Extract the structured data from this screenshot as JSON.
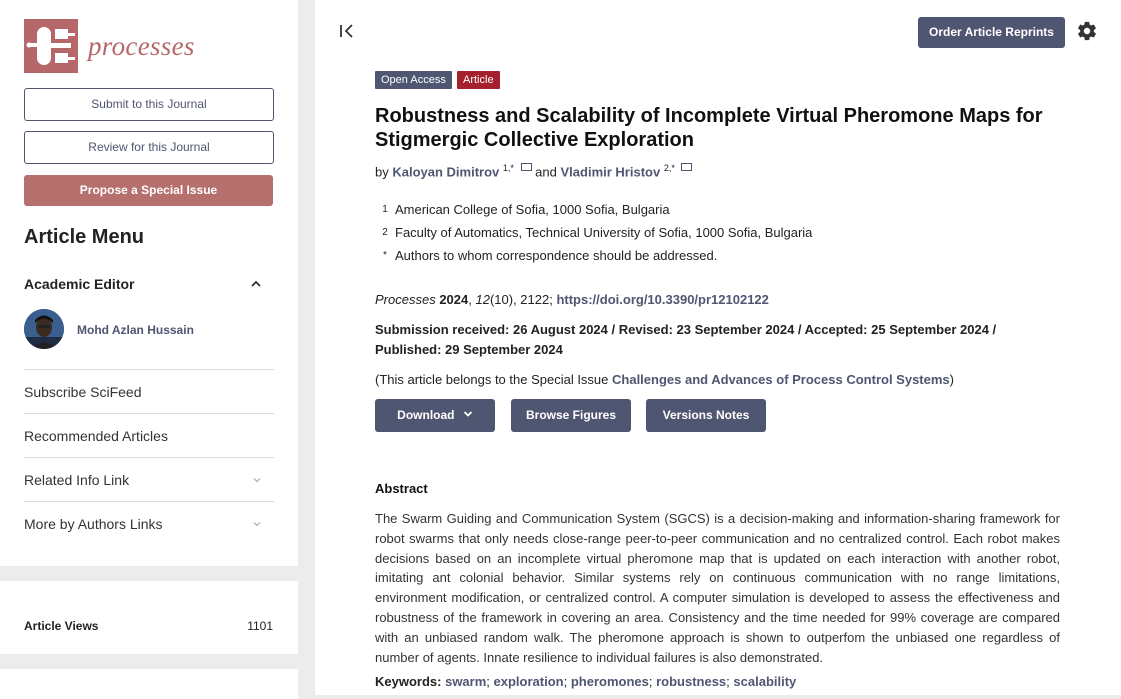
{
  "journal": {
    "name": "processes"
  },
  "sidebar": {
    "submit_label": "Submit to this Journal",
    "review_label": "Review for this Journal",
    "propose_label": "Propose a Special Issue",
    "menu_title": "Article Menu",
    "academic_editor_title": "Academic Editor",
    "editor_name": "Mohd Azlan Hussain",
    "items": [
      {
        "label": "Subscribe SciFeed"
      },
      {
        "label": "Recommended Articles"
      },
      {
        "label": "Related Info Link"
      },
      {
        "label": "More by Authors Links"
      }
    ],
    "article_views_label": "Article Views",
    "article_views_value": "1101"
  },
  "header": {
    "reprints_label": "Order Article Reprints"
  },
  "article": {
    "badges": {
      "open_access": "Open Access",
      "type": "Article"
    },
    "title": "Robustness and Scalability of Incomplete Virtual Pheromone Maps for Stigmergic Collective Exploration",
    "by": "by",
    "author1": {
      "name": "Kaloyan Dimitrov",
      "sup": "1,*"
    },
    "and": "and",
    "author2": {
      "name": "Vladimir Hristov",
      "sup": "2,*"
    },
    "affiliations": [
      {
        "num": "1",
        "text": "American College of Sofia, 1000 Sofia, Bulgaria"
      },
      {
        "num": "2",
        "text": "Faculty of Automatics, Technical University of Sofia, 1000 Sofia, Bulgaria"
      },
      {
        "num": "*",
        "text": "Authors to whom correspondence should be addressed."
      }
    ],
    "citation": {
      "journal": "Processes",
      "year": "2024",
      "volume": "12",
      "issue": "(10), 2122; ",
      "doi": "https://doi.org/10.3390/pr12102122"
    },
    "dates": "Submission received: 26 August 2024 / Revised: 23 September 2024 / Accepted: 25 September 2024 / Published: 29 September 2024",
    "special_issue": {
      "prefix": "(This article belongs to the Special Issue ",
      "name": "Challenges and Advances of Process Control Systems",
      "suffix": ")"
    },
    "buttons": {
      "download": "Download",
      "browse_figures": "Browse Figures",
      "versions_notes": "Versions Notes"
    },
    "abstract_heading": "Abstract",
    "abstract": "The Swarm Guiding and Communication System (SGCS) is a decision-making and information-sharing framework for robot swarms that only needs close-range peer-to-peer communication and no centralized control. Each robot makes decisions based on an incomplete virtual pheromone map that is updated on each interaction with another robot, imitating ant colonial behavior. Similar systems rely on continuous communication with no range limitations, environment modification, or centralized control. A computer simulation is developed to assess the effectiveness and robustness of the framework in covering an area. Consistency and the time needed for 99% coverage are compared with an unbiased random walk. The pheromone approach is shown to outperfom the unbiased one regardless of number of agents. Innate resilience to individual failures is also demonstrated.",
    "keywords_label": "Keywords:",
    "keywords": [
      "swarm",
      "exploration",
      "pheromones",
      "robustness",
      "scalability"
    ]
  },
  "colors": {
    "accent": "#4f5671",
    "brand": "#b5676a",
    "article_badge": "#a4202c"
  }
}
